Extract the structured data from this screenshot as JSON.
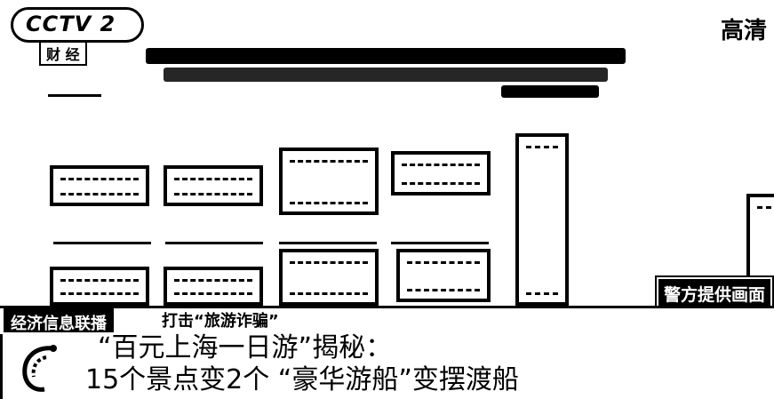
{
  "channel": {
    "logo_text": "CCTV 2",
    "sub_label": "财 经",
    "corner_text": "高清"
  },
  "overlay": {
    "source_label": "警方提供画面"
  },
  "lower_third": {
    "program": "经济信息联播",
    "topic": "打击“旅游诈骗”",
    "headline_line1": "“百元上海一日游”揭秘：",
    "headline_line2": "15个景点变2个 “豪华游船”变摆渡船"
  },
  "icons": {
    "program_icon": "swirl-logo-icon"
  }
}
